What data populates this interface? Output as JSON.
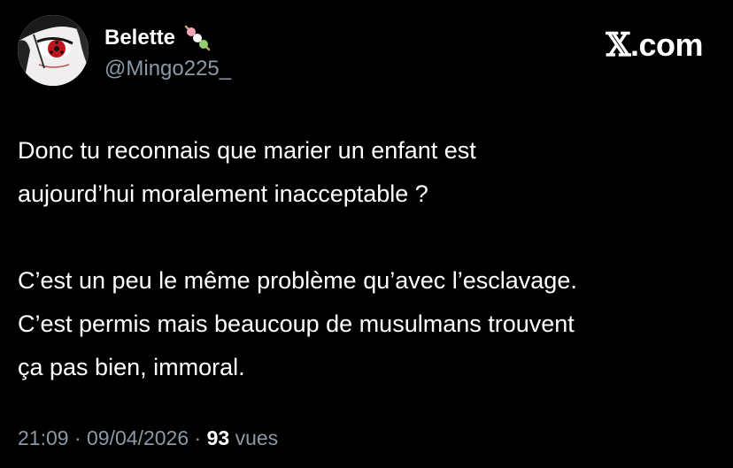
{
  "author": {
    "display_name": "Belette",
    "handle": "@Mingo225_",
    "avatar_icon": "anime-sharingan-avatar",
    "name_emoji_icon": "dango-icon"
  },
  "brand": {
    "label_x": "𝕏",
    "label_domain": ".com"
  },
  "tweet": {
    "lines": [
      "Donc tu reconnais que marier un enfant est",
      "aujourd’hui moralement inacceptable ?",
      "",
      "C’est un peu le même problème qu’avec l’esclavage.",
      "C’est permis mais beaucoup de musulmans trouvent",
      "ça pas bien, immoral."
    ]
  },
  "meta": {
    "time": "21:09",
    "sep1": "·",
    "date": "09/04/2026",
    "sep2": "·",
    "views": "93",
    "views_label": "vues"
  },
  "colors": {
    "background": "#000000",
    "text": "#ffffff",
    "secondary": "#8b98a5"
  }
}
